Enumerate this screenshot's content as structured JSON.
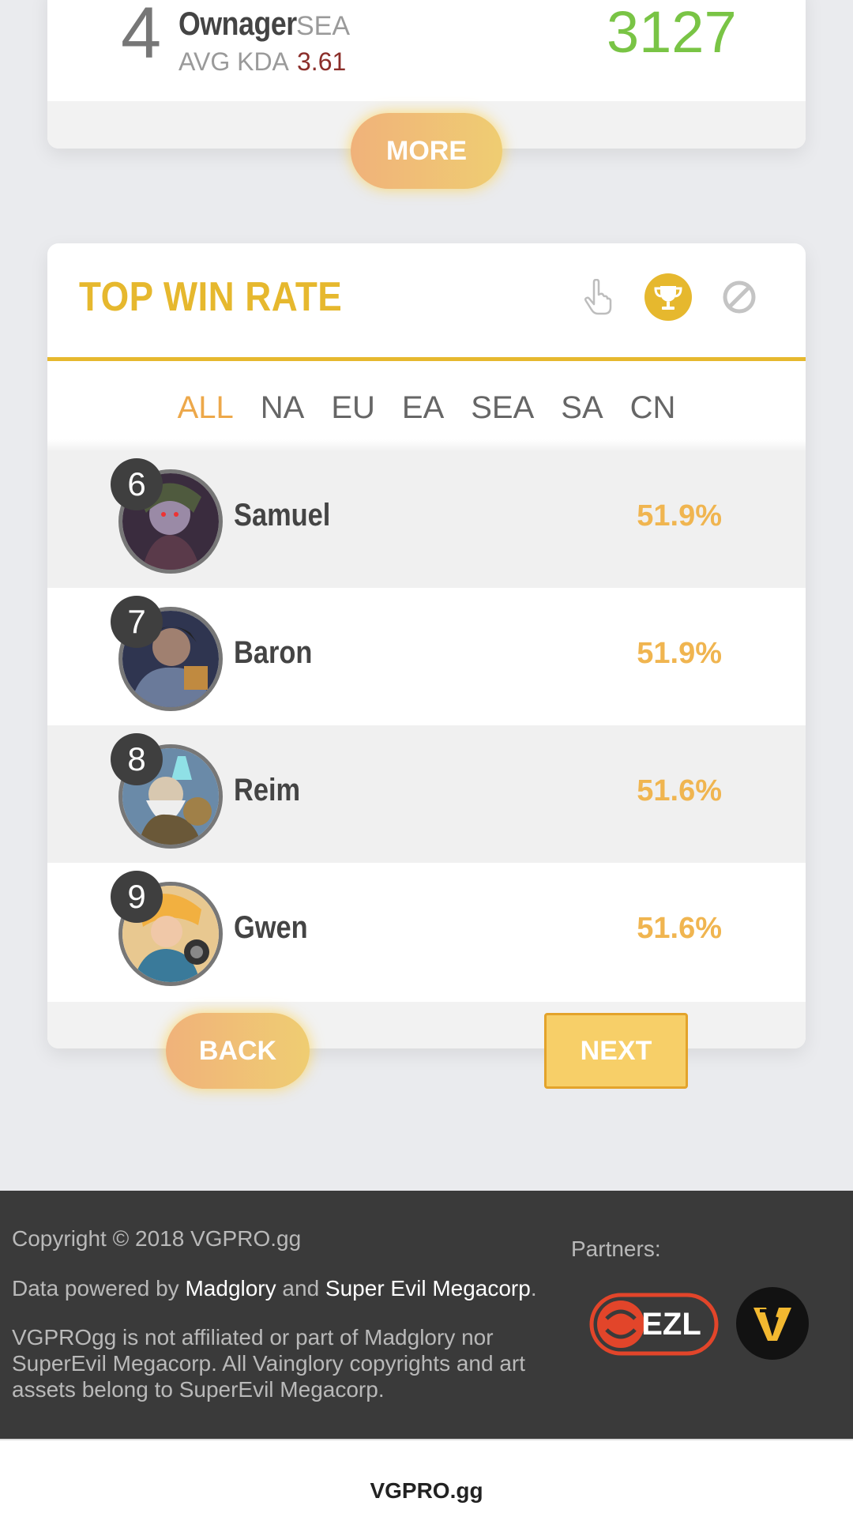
{
  "top_card": {
    "rank": "4",
    "player_name": "Ownager",
    "region": "SEA",
    "kda_label": "AVG KDA",
    "kda_value": "3.61",
    "score": "3127",
    "more_label": "MORE"
  },
  "win_rate": {
    "title": "TOP WIN RATE",
    "header_icons": [
      "hand-pointer-icon",
      "trophy-icon",
      "ban-icon"
    ],
    "tabs": [
      "ALL",
      "NA",
      "EU",
      "EA",
      "SEA",
      "SA",
      "CN"
    ],
    "active_tab": "ALL",
    "heroes": [
      {
        "rank": "6",
        "name": "Samuel",
        "rate": "51.9%"
      },
      {
        "rank": "7",
        "name": "Baron",
        "rate": "51.9%"
      },
      {
        "rank": "8",
        "name": "Reim",
        "rate": "51.6%"
      },
      {
        "rank": "9",
        "name": "Gwen",
        "rate": "51.6%"
      }
    ],
    "back_label": "BACK",
    "next_label": "NEXT"
  },
  "footer": {
    "copyright": "Copyright © 2018 VGPRO.gg",
    "powered_prefix": "Data powered by ",
    "powered_link1": "Madglory",
    "powered_and": " and ",
    "powered_link2": "Super Evil Megacorp",
    "powered_suffix": ".",
    "disclaimer_line1": "VGPROgg is not affiliated or part of Madglory nor",
    "disclaimer_line2": "SuperEvil Megacorp. All Vainglory copyrights and art",
    "disclaimer_line3": "assets belong to SuperEvil Megacorp.",
    "partners_label": "Partners:",
    "partner_logos": [
      "ezl-logo",
      "vl-logo"
    ],
    "ezl_text": "EZL"
  },
  "bottom_bar": {
    "title": "VGPRO.gg"
  },
  "colors": {
    "accent": "#e6b82e",
    "rate": "#f0b550",
    "score": "#79c445",
    "kda": "#8b2e2a"
  }
}
